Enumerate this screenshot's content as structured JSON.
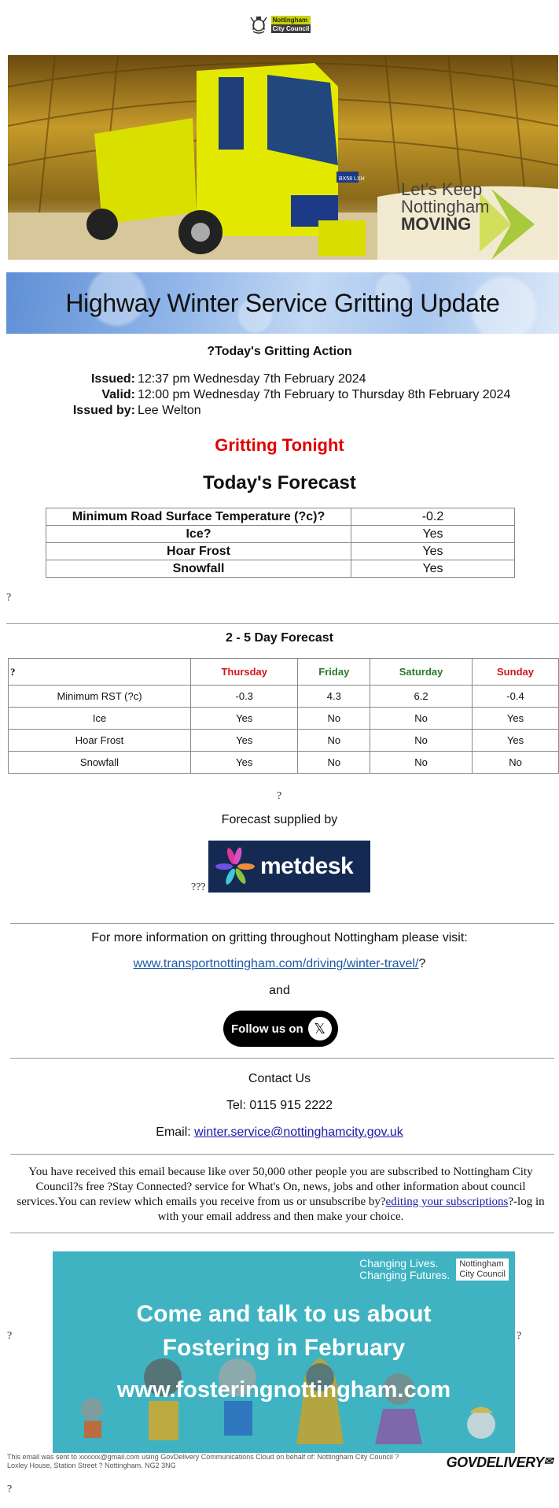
{
  "header": {
    "logo_line1": "Nottingham",
    "logo_line2": "City Council"
  },
  "hero": {
    "tag_line1": "Let's Keep",
    "tag_line2": "Nottingham",
    "tag_line3": "MOVING",
    "truck_plate": "BX58 LXH"
  },
  "banner": {
    "title": "Highway Winter Service Gritting Update"
  },
  "gritting_action": {
    "title": "?Today's Gritting Action",
    "issued_label": "Issued:",
    "issued_value": "12:37 pm Wednesday 7th February 2024",
    "valid_label": "Valid:",
    "valid_value": "12:00 pm Wednesday 7th February to Thursday 8th February 2024",
    "issued_by_label": "Issued by:",
    "issued_by_value": "Lee Welton"
  },
  "status": {
    "text": "Gritting Tonight",
    "color": "#e00000"
  },
  "todays_forecast": {
    "title": "Today's Forecast",
    "rows": [
      {
        "label": "Minimum Road Surface Temperature (?c)?",
        "value": "-0.2"
      },
      {
        "label": "Ice?",
        "value": "Yes"
      },
      {
        "label": "Hoar Frost",
        "value": "Yes"
      },
      {
        "label": "Snowfall",
        "value": "Yes"
      }
    ]
  },
  "placeholder_char": "?",
  "five_day": {
    "title": "2 - 5 Day Forecast",
    "corner": "?",
    "days": [
      {
        "name": "Thursday",
        "color": "#d01818"
      },
      {
        "name": "Friday",
        "color": "#2a7a2a"
      },
      {
        "name": "Saturday",
        "color": "#2a7a2a"
      },
      {
        "name": "Sunday",
        "color": "#d01818"
      }
    ],
    "rows": [
      {
        "label": "Minimum RST (?c)",
        "values": [
          "-0.3",
          "4.3",
          "6.2",
          "-0.4"
        ]
      },
      {
        "label": "Ice",
        "values": [
          "Yes",
          "No",
          "No",
          "Yes"
        ]
      },
      {
        "label": "Hoar Frost",
        "values": [
          "Yes",
          "No",
          "No",
          "Yes"
        ]
      },
      {
        "label": "Snowfall",
        "values": [
          "Yes",
          "No",
          "No",
          "No"
        ]
      }
    ]
  },
  "supplier": {
    "label": "Forecast supplied by",
    "prefix": "???",
    "brand": "metdesk"
  },
  "more_info": {
    "text": "For more information on gritting throughout Nottingham please visit:",
    "link": "www.transportnottingham.com/driving/winter-travel/",
    "link_suffix": "?",
    "and": "and",
    "follow_label": "Follow us on",
    "follow_icon": "x-logo-icon"
  },
  "contact": {
    "title": "Contact Us",
    "tel": "Tel: 0115 915 2222",
    "email_label": "Email: ",
    "email": "winter.service@nottinghamcity.gov.uk"
  },
  "disclaimer": {
    "text_before": "You have received this email because like over 50,000 other people you are subscribed to Nottingham City Council?s free ?Stay Connected? service for What's On, news, jobs and other information about council services.You can review which emails you receive from us or unsubscribe by?",
    "link": "editing your subscriptions",
    "text_after": "?-log in with your email address and then make your choice."
  },
  "fostering": {
    "tagline1": "Changing Lives.",
    "tagline2": "Changing Futures.",
    "ncc1": "Nottingham",
    "ncc2": "City Council",
    "headline1": "Come and talk to us about",
    "headline2": "Fostering in February",
    "url": "www.fosteringnottingham.com"
  },
  "footer": {
    "line1": "This email was sent to xxxxxx@gmail.com using GovDelivery Communications Cloud on behalf of: Nottingham City Council ?",
    "line2": "Loxley House, Station Street ? Nottingham. NG2 3NG",
    "brand": "GOVDELIVERY"
  }
}
